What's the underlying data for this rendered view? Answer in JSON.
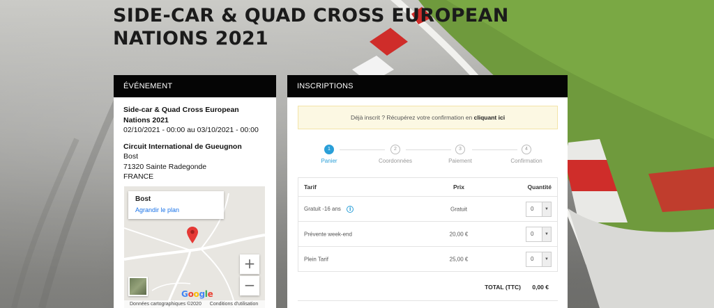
{
  "page": {
    "title": "SIDE-CAR & QUAD CROSS EUROPEAN NATIONS 2021"
  },
  "event": {
    "header": "ÉVÉNEMENT",
    "name": "Side-car & Quad Cross European Nations 2021",
    "dates": "02/10/2021 - 00:00 au 03/10/2021 - 00:00",
    "venue": "Circuit International de Gueugnon",
    "address_line1": "Bost",
    "address_line2": "71320 Sainte Radegonde",
    "country": "FRANCE"
  },
  "map": {
    "place_name": "Bost",
    "enlarge_link": "Agrandir le plan",
    "zoom_in": "+",
    "zoom_out": "−",
    "logo": "Google",
    "attribution": "Données cartographiques ©2020",
    "terms": "Conditions d'utilisation",
    "pin_icon": "map-pin-icon",
    "pin_color": "#e53935"
  },
  "inscriptions": {
    "header": "INSCRIPTIONS",
    "alert_text": "Déjà inscrit ? Récupérez votre confirmation en",
    "alert_link": "cliquant ici",
    "steps": [
      {
        "number": "1",
        "label": "Panier",
        "active": true
      },
      {
        "number": "2",
        "label": "Coordonnées",
        "active": false
      },
      {
        "number": "3",
        "label": "Paiement",
        "active": false
      },
      {
        "number": "4",
        "label": "Confirmation",
        "active": false
      }
    ],
    "accent_color": "#2a9fd8",
    "table": {
      "headers": {
        "tarif": "Tarif",
        "prix": "Prix",
        "quantite": "Quantité"
      },
      "rows": [
        {
          "name": "Gratuit -16 ans",
          "price": "Gratuit",
          "qty": "0",
          "info_icon": "info-icon"
        },
        {
          "name": "Prévente week-end",
          "price": "20,00 €",
          "qty": "0"
        },
        {
          "name": "Plein Tarif",
          "price": "25,00 €",
          "qty": "0"
        }
      ]
    },
    "total_label": "TOTAL (TTC)",
    "total_value": "0,00 €"
  }
}
